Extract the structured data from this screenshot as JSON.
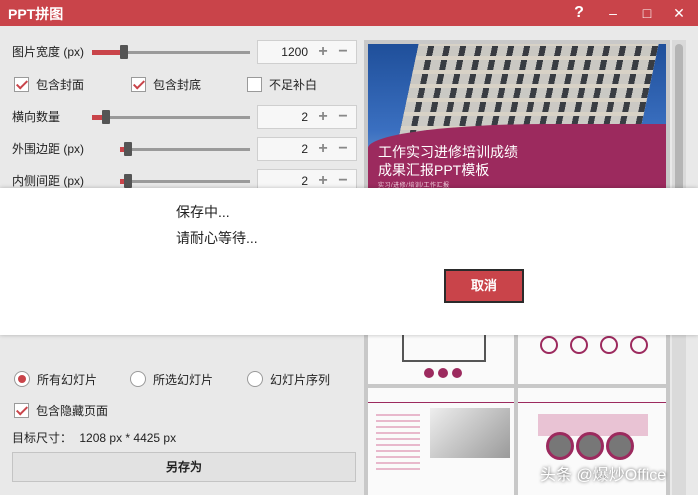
{
  "window": {
    "title": "PPT拼图",
    "help": "?",
    "minimize": "‒",
    "maximize": "□",
    "close": "✕"
  },
  "settings": {
    "image_width": {
      "label": "图片宽度 (px)",
      "value": "1200",
      "slider_fraction": 0.32
    },
    "include_cover": {
      "label": "包含封面",
      "checked": true
    },
    "include_back_cover": {
      "label": "包含封底",
      "checked": true
    },
    "fill_blank": {
      "label": "不足补白",
      "checked": false
    },
    "horizontal_count": {
      "label": "横向数量",
      "value": "2",
      "slider_fraction": 0.05
    },
    "outer_margin": {
      "label": "外围边距 (px)",
      "value": "2",
      "slider_fraction": 0.05
    },
    "inner_spacing": {
      "label": "内侧间距 (px)",
      "value": "2",
      "slider_fraction": 0.05
    },
    "spin_plus": "+",
    "spin_minus": "−"
  },
  "scope": {
    "all_slides": {
      "label": "所有幻灯片",
      "selected": true
    },
    "selected_slides": {
      "label": "所选幻灯片",
      "selected": false
    },
    "slide_sequence": {
      "label": "幻灯片序列",
      "selected": false
    }
  },
  "include_hidden": {
    "label": "包含隐藏页面",
    "checked": true
  },
  "target_size": {
    "label": "目标尺寸：",
    "value": "1208 px *  4425 px"
  },
  "save_as_label": "另存为",
  "preview": {
    "cover_title_line1": "工作实习进修培训成绩",
    "cover_title_line2": "成果汇报PPT模板",
    "cover_subtitle": "实习/进修/培训/工作汇报"
  },
  "dialog": {
    "line1": "保存中...",
    "line2": "请耐心等待...",
    "cancel_label": "取消"
  },
  "watermark": "头条 @爆炒Office",
  "colors": {
    "accent": "#c9444a",
    "slide_band": "#9c2a5e"
  }
}
